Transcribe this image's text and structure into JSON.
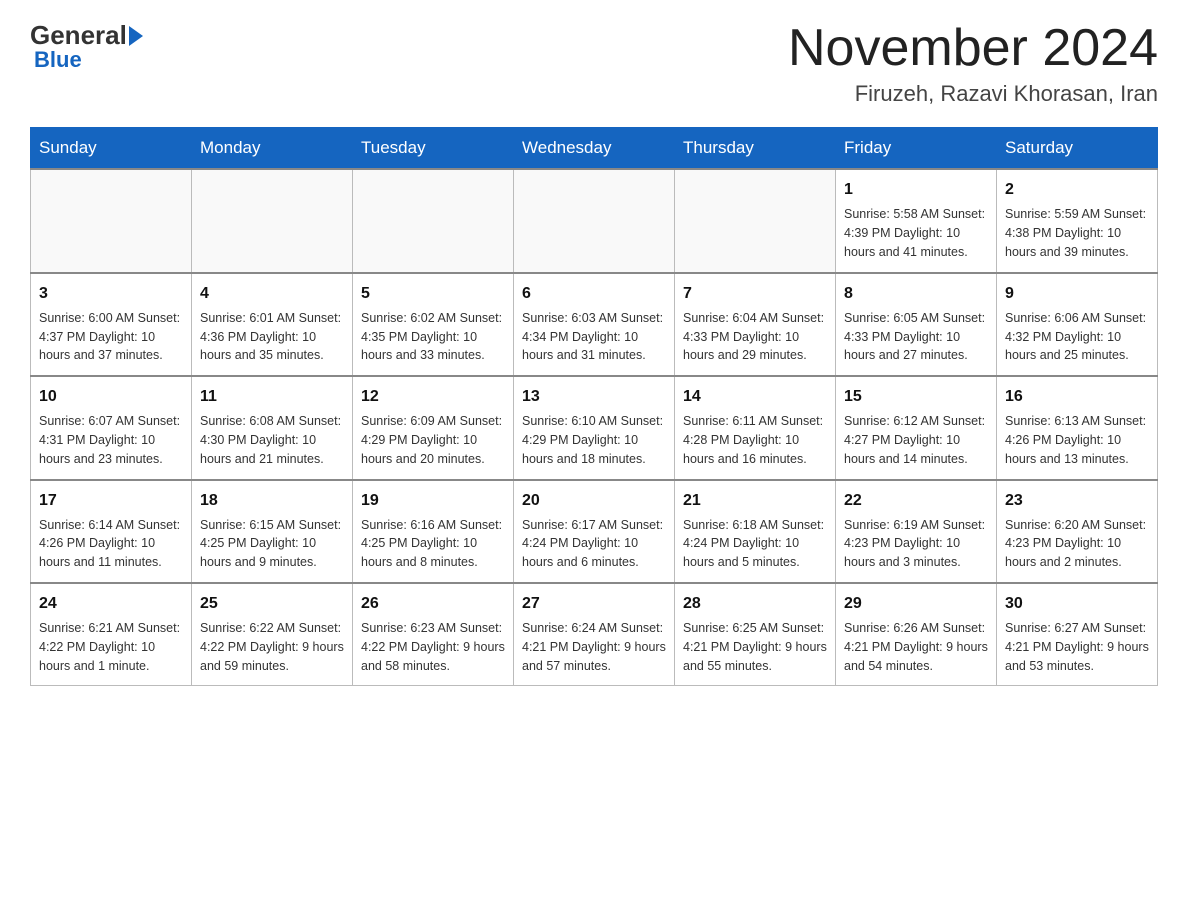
{
  "header": {
    "logo_general": "General",
    "logo_blue": "Blue",
    "title": "November 2024",
    "subtitle": "Firuzeh, Razavi Khorasan, Iran"
  },
  "days_of_week": [
    "Sunday",
    "Monday",
    "Tuesday",
    "Wednesday",
    "Thursday",
    "Friday",
    "Saturday"
  ],
  "weeks": [
    {
      "days": [
        {
          "num": "",
          "info": ""
        },
        {
          "num": "",
          "info": ""
        },
        {
          "num": "",
          "info": ""
        },
        {
          "num": "",
          "info": ""
        },
        {
          "num": "",
          "info": ""
        },
        {
          "num": "1",
          "info": "Sunrise: 5:58 AM\nSunset: 4:39 PM\nDaylight: 10 hours and 41 minutes."
        },
        {
          "num": "2",
          "info": "Sunrise: 5:59 AM\nSunset: 4:38 PM\nDaylight: 10 hours and 39 minutes."
        }
      ]
    },
    {
      "days": [
        {
          "num": "3",
          "info": "Sunrise: 6:00 AM\nSunset: 4:37 PM\nDaylight: 10 hours and 37 minutes."
        },
        {
          "num": "4",
          "info": "Sunrise: 6:01 AM\nSunset: 4:36 PM\nDaylight: 10 hours and 35 minutes."
        },
        {
          "num": "5",
          "info": "Sunrise: 6:02 AM\nSunset: 4:35 PM\nDaylight: 10 hours and 33 minutes."
        },
        {
          "num": "6",
          "info": "Sunrise: 6:03 AM\nSunset: 4:34 PM\nDaylight: 10 hours and 31 minutes."
        },
        {
          "num": "7",
          "info": "Sunrise: 6:04 AM\nSunset: 4:33 PM\nDaylight: 10 hours and 29 minutes."
        },
        {
          "num": "8",
          "info": "Sunrise: 6:05 AM\nSunset: 4:33 PM\nDaylight: 10 hours and 27 minutes."
        },
        {
          "num": "9",
          "info": "Sunrise: 6:06 AM\nSunset: 4:32 PM\nDaylight: 10 hours and 25 minutes."
        }
      ]
    },
    {
      "days": [
        {
          "num": "10",
          "info": "Sunrise: 6:07 AM\nSunset: 4:31 PM\nDaylight: 10 hours and 23 minutes."
        },
        {
          "num": "11",
          "info": "Sunrise: 6:08 AM\nSunset: 4:30 PM\nDaylight: 10 hours and 21 minutes."
        },
        {
          "num": "12",
          "info": "Sunrise: 6:09 AM\nSunset: 4:29 PM\nDaylight: 10 hours and 20 minutes."
        },
        {
          "num": "13",
          "info": "Sunrise: 6:10 AM\nSunset: 4:29 PM\nDaylight: 10 hours and 18 minutes."
        },
        {
          "num": "14",
          "info": "Sunrise: 6:11 AM\nSunset: 4:28 PM\nDaylight: 10 hours and 16 minutes."
        },
        {
          "num": "15",
          "info": "Sunrise: 6:12 AM\nSunset: 4:27 PM\nDaylight: 10 hours and 14 minutes."
        },
        {
          "num": "16",
          "info": "Sunrise: 6:13 AM\nSunset: 4:26 PM\nDaylight: 10 hours and 13 minutes."
        }
      ]
    },
    {
      "days": [
        {
          "num": "17",
          "info": "Sunrise: 6:14 AM\nSunset: 4:26 PM\nDaylight: 10 hours and 11 minutes."
        },
        {
          "num": "18",
          "info": "Sunrise: 6:15 AM\nSunset: 4:25 PM\nDaylight: 10 hours and 9 minutes."
        },
        {
          "num": "19",
          "info": "Sunrise: 6:16 AM\nSunset: 4:25 PM\nDaylight: 10 hours and 8 minutes."
        },
        {
          "num": "20",
          "info": "Sunrise: 6:17 AM\nSunset: 4:24 PM\nDaylight: 10 hours and 6 minutes."
        },
        {
          "num": "21",
          "info": "Sunrise: 6:18 AM\nSunset: 4:24 PM\nDaylight: 10 hours and 5 minutes."
        },
        {
          "num": "22",
          "info": "Sunrise: 6:19 AM\nSunset: 4:23 PM\nDaylight: 10 hours and 3 minutes."
        },
        {
          "num": "23",
          "info": "Sunrise: 6:20 AM\nSunset: 4:23 PM\nDaylight: 10 hours and 2 minutes."
        }
      ]
    },
    {
      "days": [
        {
          "num": "24",
          "info": "Sunrise: 6:21 AM\nSunset: 4:22 PM\nDaylight: 10 hours and 1 minute."
        },
        {
          "num": "25",
          "info": "Sunrise: 6:22 AM\nSunset: 4:22 PM\nDaylight: 9 hours and 59 minutes."
        },
        {
          "num": "26",
          "info": "Sunrise: 6:23 AM\nSunset: 4:22 PM\nDaylight: 9 hours and 58 minutes."
        },
        {
          "num": "27",
          "info": "Sunrise: 6:24 AM\nSunset: 4:21 PM\nDaylight: 9 hours and 57 minutes."
        },
        {
          "num": "28",
          "info": "Sunrise: 6:25 AM\nSunset: 4:21 PM\nDaylight: 9 hours and 55 minutes."
        },
        {
          "num": "29",
          "info": "Sunrise: 6:26 AM\nSunset: 4:21 PM\nDaylight: 9 hours and 54 minutes."
        },
        {
          "num": "30",
          "info": "Sunrise: 6:27 AM\nSunset: 4:21 PM\nDaylight: 9 hours and 53 minutes."
        }
      ]
    }
  ]
}
